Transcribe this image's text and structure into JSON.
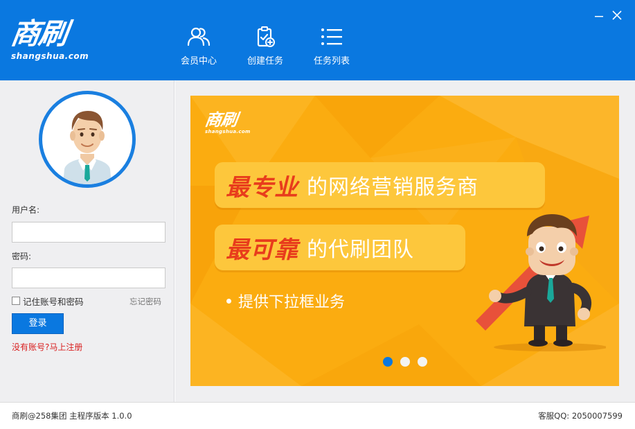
{
  "header": {
    "logo_main": "商刷",
    "logo_sub": "shangshua.com",
    "nav": [
      {
        "label": "会员中心",
        "icon": "users-icon"
      },
      {
        "label": "创建任务",
        "icon": "clipboard-add-icon"
      },
      {
        "label": "任务列表",
        "icon": "list-icon"
      }
    ],
    "window": {
      "minimize": "minimize-icon",
      "close": "close-icon"
    }
  },
  "login": {
    "username_label": "用户名:",
    "username_value": "",
    "password_label": "密码:",
    "password_value": "",
    "remember_label": "记住账号和密码",
    "remember_checked": false,
    "forgot_label": "忘记密码",
    "login_button": "登录",
    "register_link": "没有账号?马上注册"
  },
  "banner": {
    "logo_main": "商刷",
    "logo_sub": "shangshua.com",
    "line1_em": "最专业",
    "line1_rest": "的网络营销服务商",
    "line2_em": "最可靠",
    "line2_rest": "的代刷团队",
    "bullet": "提供下拉框业务",
    "slides_total": 3,
    "active_slide": 1
  },
  "footer": {
    "left": "商刷@258集团 主程序版本 1.0.0",
    "right": "客服QQ: 2050007599"
  },
  "colors": {
    "primary_blue": "#0a78e0",
    "banner_orange": "#fbac10",
    "accent_red": "#e83c1c",
    "link_red": "#d92020"
  }
}
